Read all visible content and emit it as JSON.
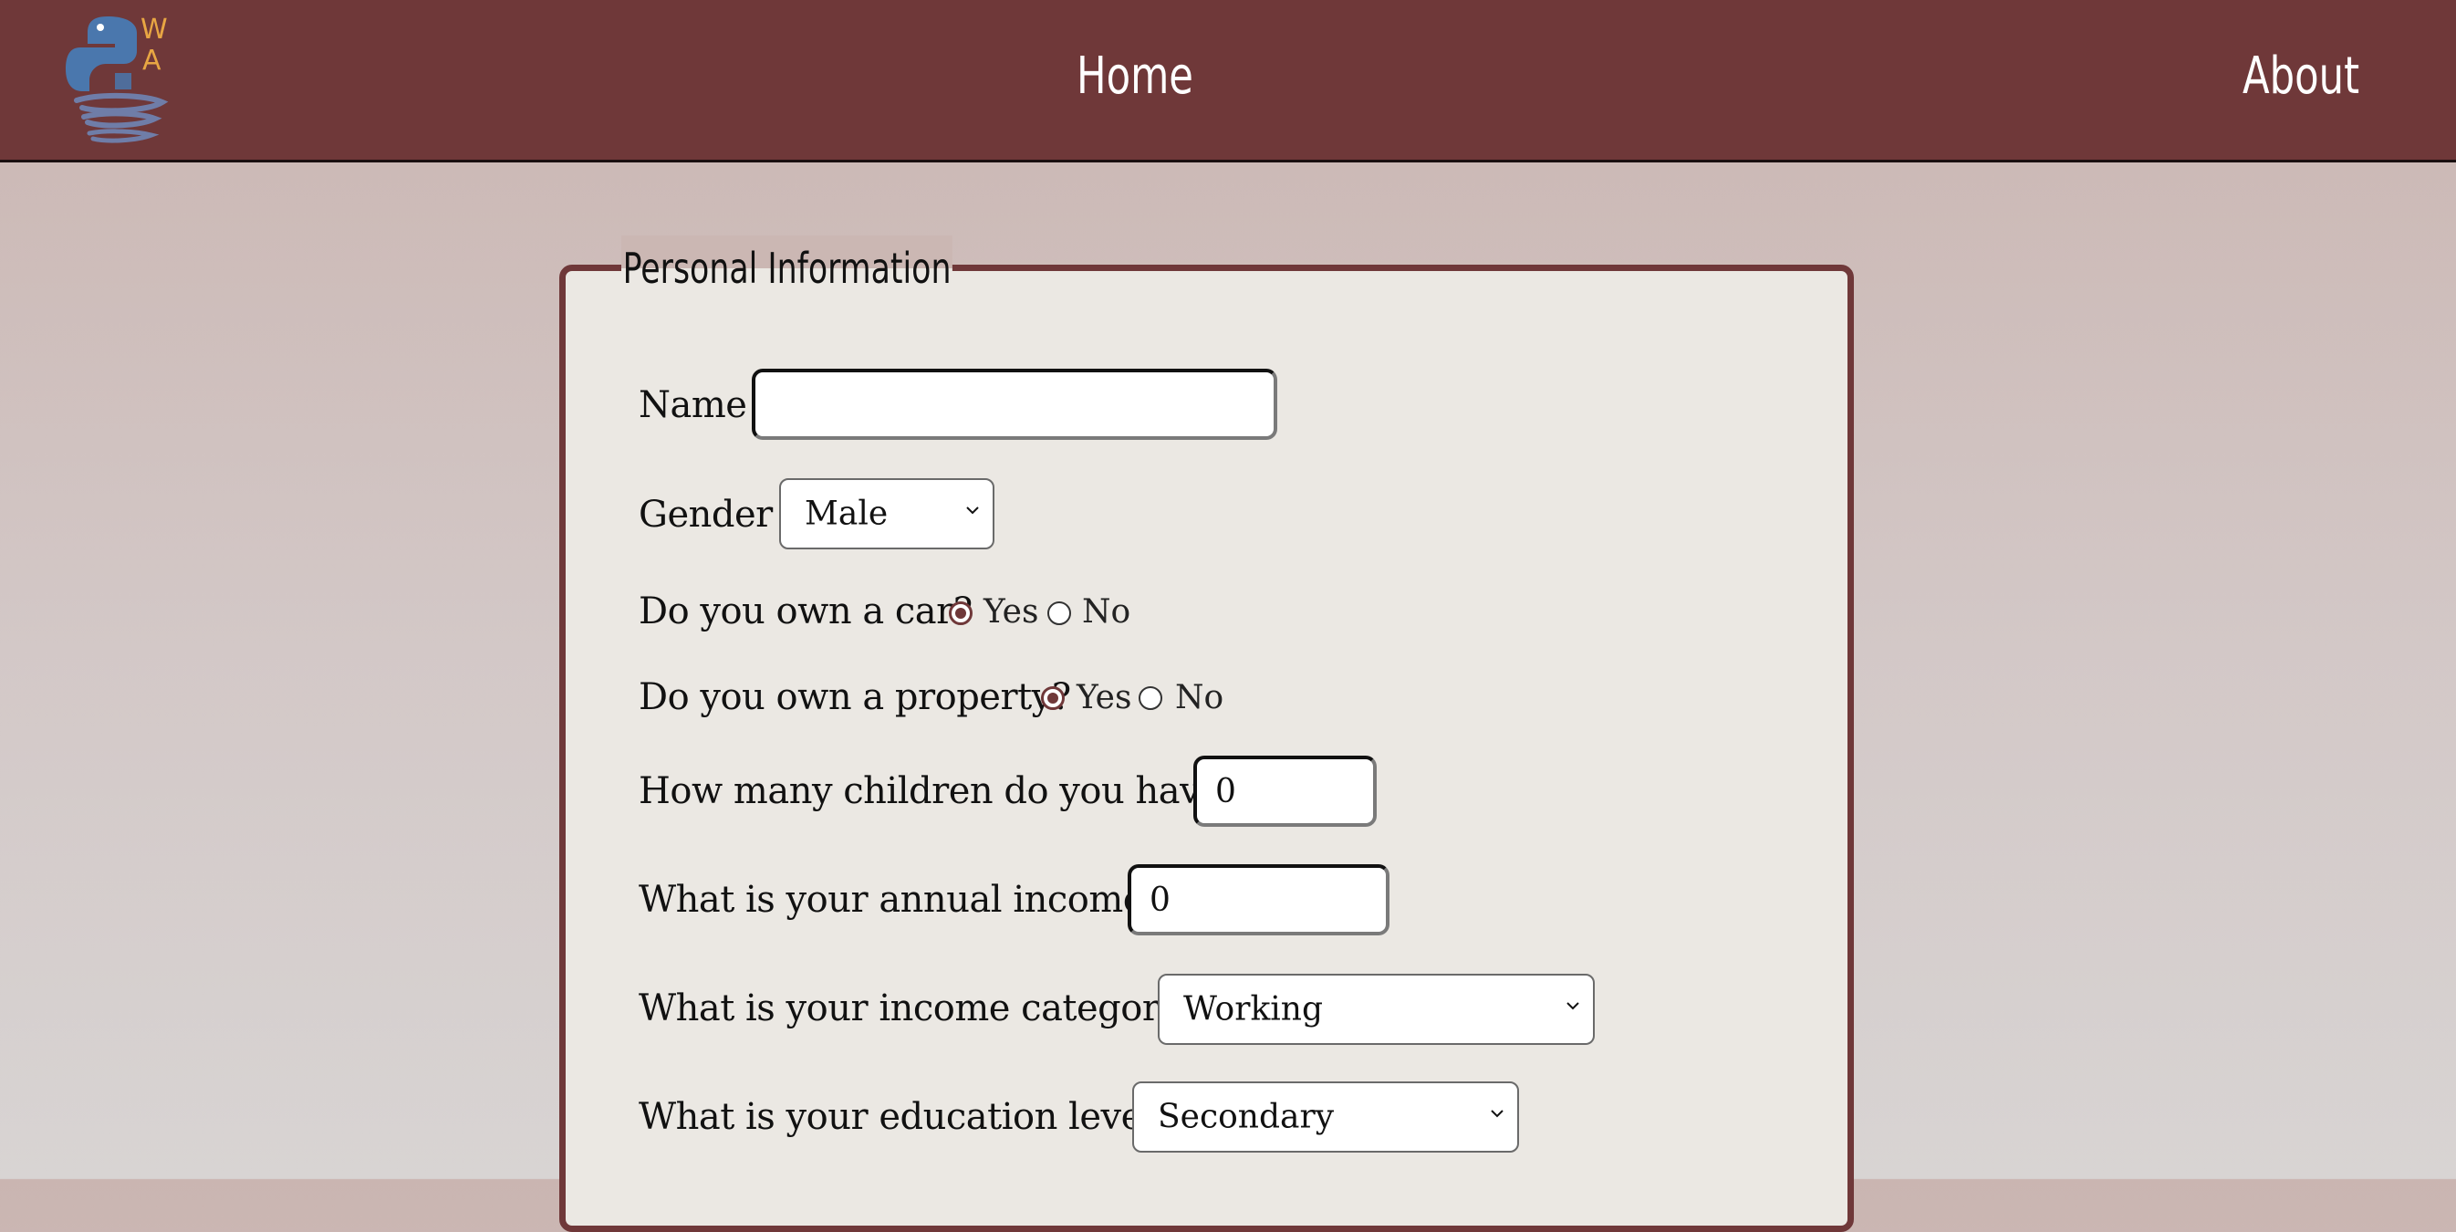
{
  "nav": {
    "logo_letters": "WA",
    "home_label": "Home",
    "about_label": "About"
  },
  "form": {
    "legend": "Personal Information",
    "name": {
      "label": "Name",
      "value": "",
      "placeholder": ""
    },
    "gender": {
      "label": "Gender",
      "selected": "Male"
    },
    "car": {
      "label": "Do you own a car?",
      "yes": "Yes",
      "no": "No",
      "selected": "Yes"
    },
    "property": {
      "label": "Do you own a property?",
      "yes": "Yes",
      "no": "No",
      "selected": "Yes"
    },
    "children": {
      "label": "How many children do you have?",
      "value": "0"
    },
    "income": {
      "label": "What is your annual income?",
      "value": "0"
    },
    "income_category": {
      "label": "What is your income category?",
      "selected": "Working"
    },
    "education": {
      "label": "What is your education level?",
      "selected": "Secondary"
    }
  },
  "colors": {
    "navbar": "#6f3839",
    "panel": "#ebe8e3",
    "accent": "#6f3839"
  },
  "icons": {
    "logo": "python-wa-logo-icon",
    "dropdown": "chevron-down-icon"
  }
}
